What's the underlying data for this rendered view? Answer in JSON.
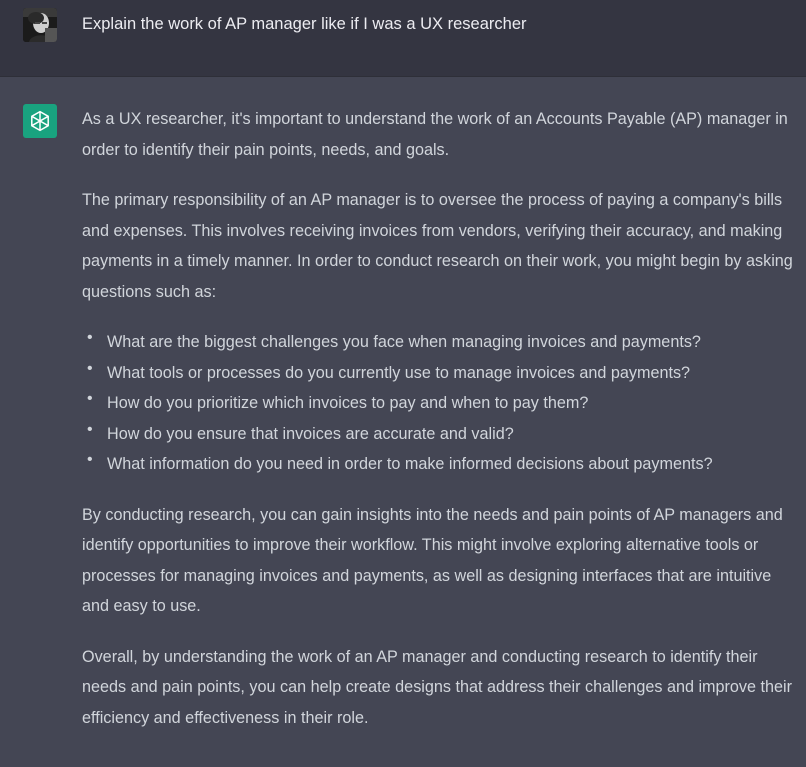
{
  "user_message": {
    "text": "Explain the work of AP manager like if I was a UX researcher"
  },
  "assistant_message": {
    "intro": "As a UX researcher, it's important to understand the work of an Accounts Payable (AP) manager in order to identify their pain points, needs, and goals.",
    "paragraph_2": "The primary responsibility of an AP manager is to oversee the process of paying a company's bills and expenses. This involves receiving invoices from vendors, verifying their accuracy, and making payments in a timely manner. In order to conduct research on their work, you might begin by asking questions such as:",
    "questions": [
      "What are the biggest challenges you face when managing invoices and payments?",
      "What tools or processes do you currently use to manage invoices and payments?",
      "How do you prioritize which invoices to pay and when to pay them?",
      "How do you ensure that invoices are accurate and valid?",
      "What information do you need in order to make informed decisions about payments?"
    ],
    "paragraph_3": "By conducting research, you can gain insights into the needs and pain points of AP managers and identify opportunities to improve their workflow. This might involve exploring alternative tools or processes for managing invoices and payments, as well as designing interfaces that are intuitive and easy to use.",
    "paragraph_4": "Overall, by understanding the work of an AP manager and conducting research to identify their needs and pain points, you can help create designs that address their challenges and improve their efficiency and effectiveness in their role."
  },
  "icons": {
    "user_avatar": "user-photo-avatar",
    "assistant_avatar": "openai-logo-icon"
  },
  "colors": {
    "user_row_bg": "#343541",
    "assistant_row_bg": "#444654",
    "assistant_avatar_bg": "#19a37f",
    "text": "#d1d5db"
  }
}
